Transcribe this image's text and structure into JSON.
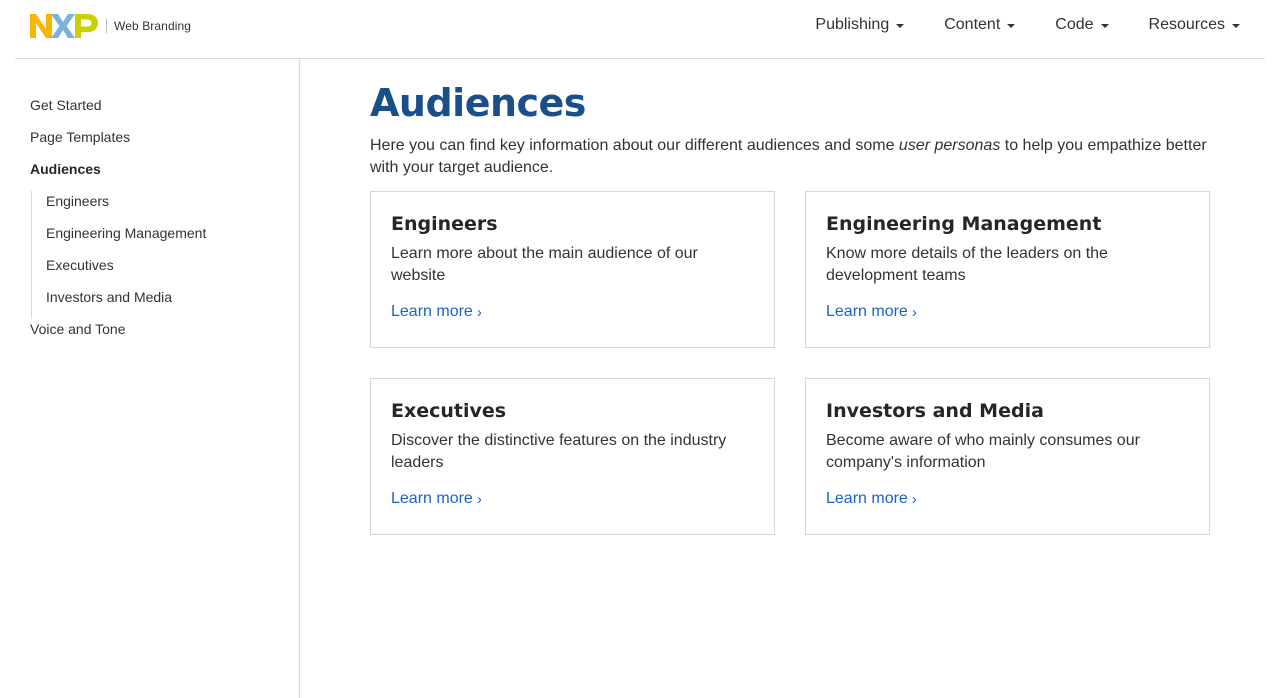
{
  "header": {
    "brand_text": "Web Branding",
    "nav": [
      {
        "label": "Publishing"
      },
      {
        "label": "Content"
      },
      {
        "label": "Code"
      },
      {
        "label": "Resources"
      }
    ]
  },
  "sidebar": {
    "items": [
      {
        "label": "Get Started"
      },
      {
        "label": "Page Templates"
      },
      {
        "label": "Audiences"
      },
      {
        "label": "Voice and Tone"
      }
    ],
    "sub_items": [
      {
        "label": "Engineers"
      },
      {
        "label": "Engineering Management"
      },
      {
        "label": "Executives"
      },
      {
        "label": "Investors and Media"
      }
    ]
  },
  "main": {
    "title": "Audiences",
    "intro_before": "Here you can find key information about our different audiences and some ",
    "intro_em": "user personas",
    "intro_after": " to help you empathize better with your target audience.",
    "cards": [
      {
        "title": "Engineers",
        "desc": "Learn more about the main audience of our website",
        "link": "Learn more"
      },
      {
        "title": "Engineering Management",
        "desc": "Know more details of the leaders on the development teams",
        "link": "Learn more"
      },
      {
        "title": "Executives",
        "desc": "Discover the distinctive features on the industry leaders",
        "link": "Learn more"
      },
      {
        "title": "Investors and Media",
        "desc": "Become aware of who mainly consumes our company's information",
        "link": "Learn more"
      }
    ]
  },
  "colors": {
    "title_blue": "#1b4f8a",
    "link_blue": "#1a62c7",
    "logo_yellow": "#f9b500",
    "logo_blue": "#7bb1db",
    "logo_green": "#c9d200"
  },
  "icons": {
    "nav_caret": "caret-down-icon",
    "link_chevron": "chevron-right-icon"
  }
}
